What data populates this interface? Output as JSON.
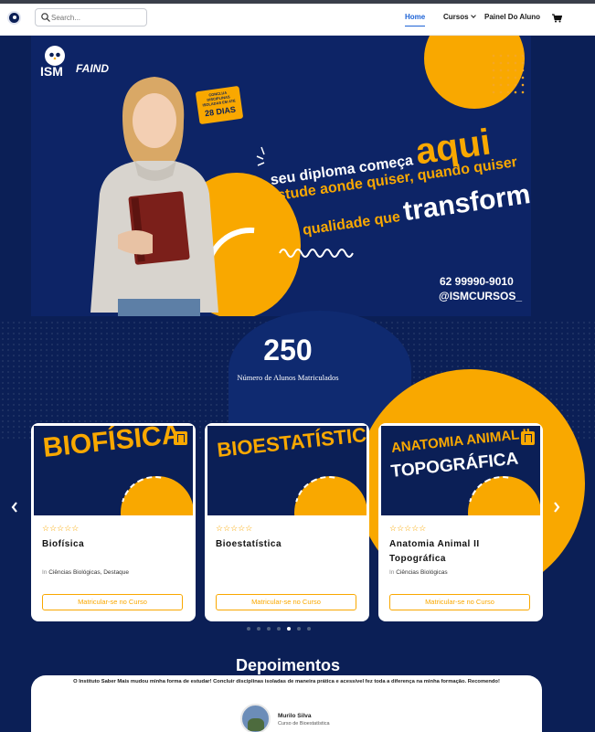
{
  "header": {
    "search": {
      "placeholder": "Search..."
    },
    "nav": {
      "home": "Home",
      "cursos": "Cursos",
      "painel": "Painel Do Aluno"
    }
  },
  "hero": {
    "logo_ism": "ISM",
    "logo_faind": "FAIND",
    "badge_small": "CONCLUA DISCIPLINAS ISOLADAS EM ATÉ",
    "badge_big": "28 DIAS",
    "line1_a": "seu diploma começa",
    "line1_b": "aqui",
    "line2": "estude aonde quiser, quando quiser",
    "line3_a": "com qualidade que",
    "line3_b": "transforma",
    "phone": "62 99990-9010",
    "handle": "@ISMCURSOS_"
  },
  "stats": {
    "count": "250",
    "label": "Número de Alunos Matriculados"
  },
  "courses": [
    {
      "thumb_line1": "BIOFÍSICA",
      "thumb_line2": "",
      "stars": "☆☆☆☆☆",
      "title": "Biofísica",
      "in": "In",
      "category": "Ciências Biológicas, Destaque",
      "button": "Matricular-se no Curso"
    },
    {
      "thumb_line1": "BIOESTATÍSTICA",
      "thumb_line2": "",
      "stars": "☆☆☆☆☆",
      "title": "Bioestatística",
      "in": "",
      "category": "",
      "button": "Matricular-se no Curso"
    },
    {
      "thumb_line1": "ANATOMIA ANIMAL II",
      "thumb_line2": "TOPOGRÁFICA",
      "stars": "☆☆☆☆☆",
      "title": "Anatomia Animal II Topográfica",
      "in": "In",
      "category": "Ciências Biológicas",
      "button": "Matricular-se no Curso"
    }
  ],
  "carousel": {
    "total_dots": 7,
    "active_dot": 5
  },
  "testimonials": {
    "title": "Depoimentos",
    "quote": "O Instituto Saber Mais mudou minha forma de estudar! Concluir disciplinas isoladas de maneira prática e acessível fez toda a diferença na minha formação. Recomendo!",
    "name": "Murilo Silva",
    "course": "Curso de Bioestatística"
  },
  "colors": {
    "navy": "#0b1f56",
    "accent": "#f9a800",
    "link": "#1e63d6"
  },
  "icons": [
    "search-icon",
    "chevron-down-icon",
    "cart-icon",
    "bookmark-icon",
    "arrow-left-icon",
    "arrow-right-icon"
  ]
}
